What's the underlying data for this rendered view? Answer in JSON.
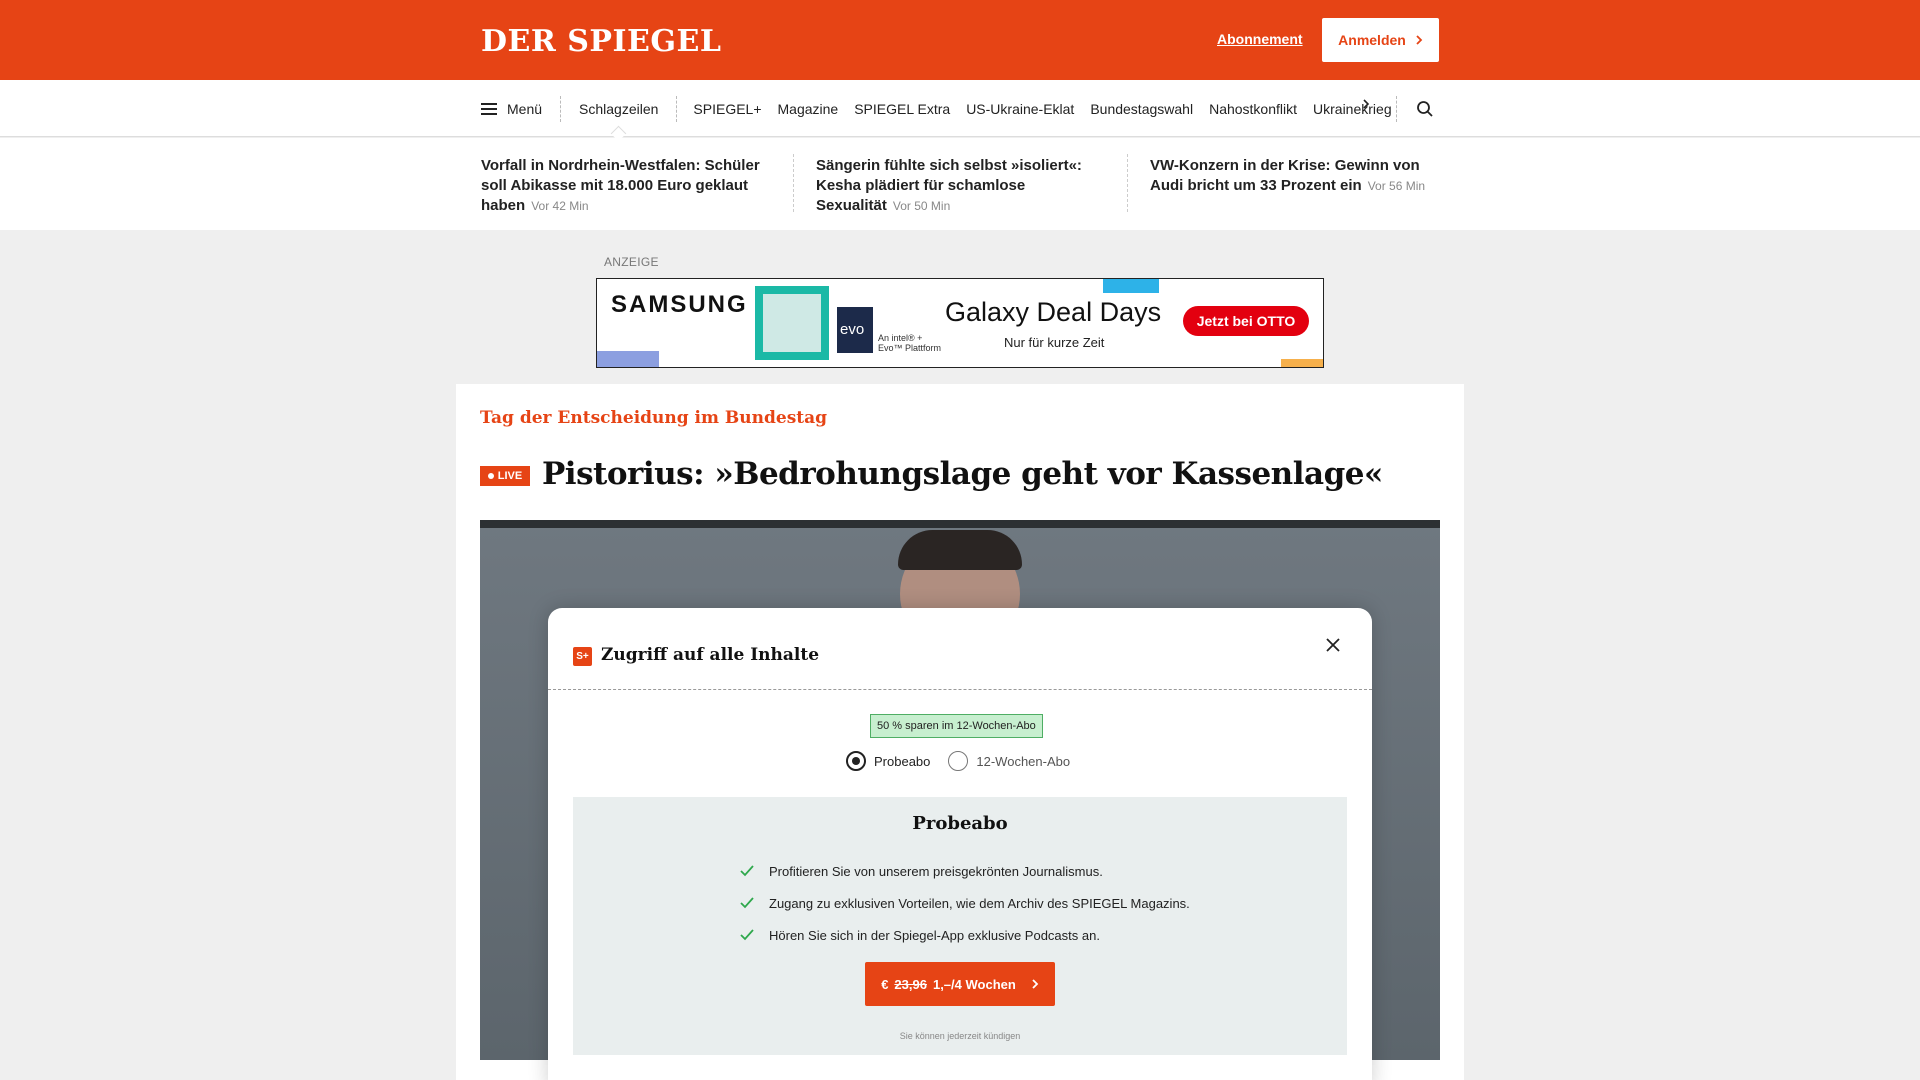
{
  "header": {
    "logo": "DER SPIEGEL",
    "abo_link": "Abonnement",
    "login_label": "Anmelden",
    "accent_color": "#e64415"
  },
  "nav": {
    "menu_label": "Menü",
    "active_item": "Schlagzeilen",
    "items": [
      "SPIEGEL+",
      "Magazine",
      "SPIEGEL Extra",
      "US-Ukraine-Eklat",
      "Bundestagswahl",
      "Nahostkonflikt",
      "Ukrainekrieg"
    ],
    "more_icon": "chevron-right-icon",
    "search_icon": "search-icon"
  },
  "teasers": [
    {
      "title": "Vorfall in Nordrhein-Westfalen: Schüler soll Abikasse mit 18.000 Euro geklaut haben",
      "time": "Vor 42 Min"
    },
    {
      "title": "Sängerin fühlte sich selbst »isoliert«: Kesha plädiert für schamlose Sexualität",
      "time": "Vor 50 Min"
    },
    {
      "title": "VW-Konzern in der Krise: Gewinn von Audi bricht um 33 Prozent ein",
      "time": "Vor 56 Min"
    }
  ],
  "ad": {
    "label": "ANZEIGE",
    "brand": "SAMSUNG",
    "evo": "evo",
    "intel_text_1": "An intel® +",
    "intel_text_2": "Evo™ Plattform",
    "headline": "Galaxy Deal Days",
    "subline": "Nur für kurze Zeit",
    "button": "Jetzt bei OTTO"
  },
  "article": {
    "kicker": "Tag der Entscheidung im Bundestag",
    "live_label": "LIVE",
    "headline": "Pistorius: »Bedrohungslage geht vor Kassenlage«"
  },
  "modal": {
    "badge": "S+",
    "title": "Zugriff auf alle Inhalte",
    "save_badge": "50 % sparen im 12-Wochen-Abo",
    "options": [
      "Probeabo",
      "12-Wochen-Abo"
    ],
    "selected_option": "Probeabo",
    "plan_title": "Probeabo",
    "benefits": [
      "Profitieren Sie von unserem preisgekrönten Journalismus.",
      "Zugang zu exklusiven Vorteilen, wie dem Archiv des SPIEGEL Magazins.",
      "Hören Sie sich in der Spiegel-App exklusive Podcasts an."
    ],
    "cta_currency": "€",
    "cta_old_price": "23,96",
    "cta_new_price": "1,–/4 Wochen",
    "cancel_note": "Sie können jederzeit kündigen"
  }
}
